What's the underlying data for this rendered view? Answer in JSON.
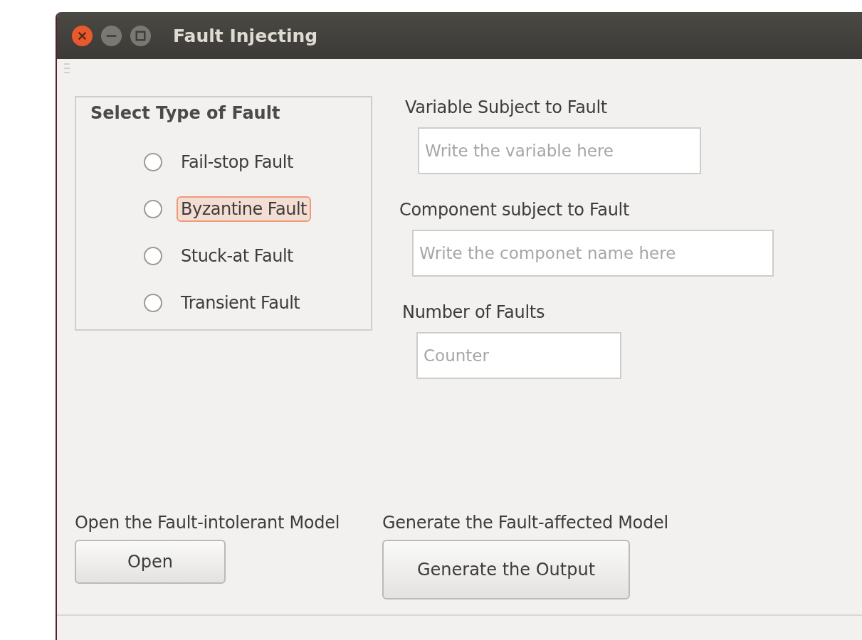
{
  "window": {
    "title": "Fault Injecting"
  },
  "fault_type": {
    "title": "Select Type of Fault",
    "options": [
      {
        "label": "Fail-stop Fault",
        "selected": false,
        "focused": false
      },
      {
        "label": "Byzantine Fault",
        "selected": false,
        "focused": true
      },
      {
        "label": "Stuck-at Fault",
        "selected": false,
        "focused": false
      },
      {
        "label": "Transient Fault",
        "selected": false,
        "focused": false
      }
    ]
  },
  "fields": [
    {
      "label": "Variable Subject to Fault",
      "placeholder": "Write the variable here"
    },
    {
      "label": "Component subject to Fault",
      "placeholder": "Write the componet name here"
    },
    {
      "label": "Number of Faults",
      "placeholder": "Counter"
    }
  ],
  "actions": [
    {
      "label": "Open the Fault-intolerant Model",
      "button": "Open"
    },
    {
      "label": "Generate the Fault-affected Model",
      "button": "Generate the Output"
    }
  ]
}
